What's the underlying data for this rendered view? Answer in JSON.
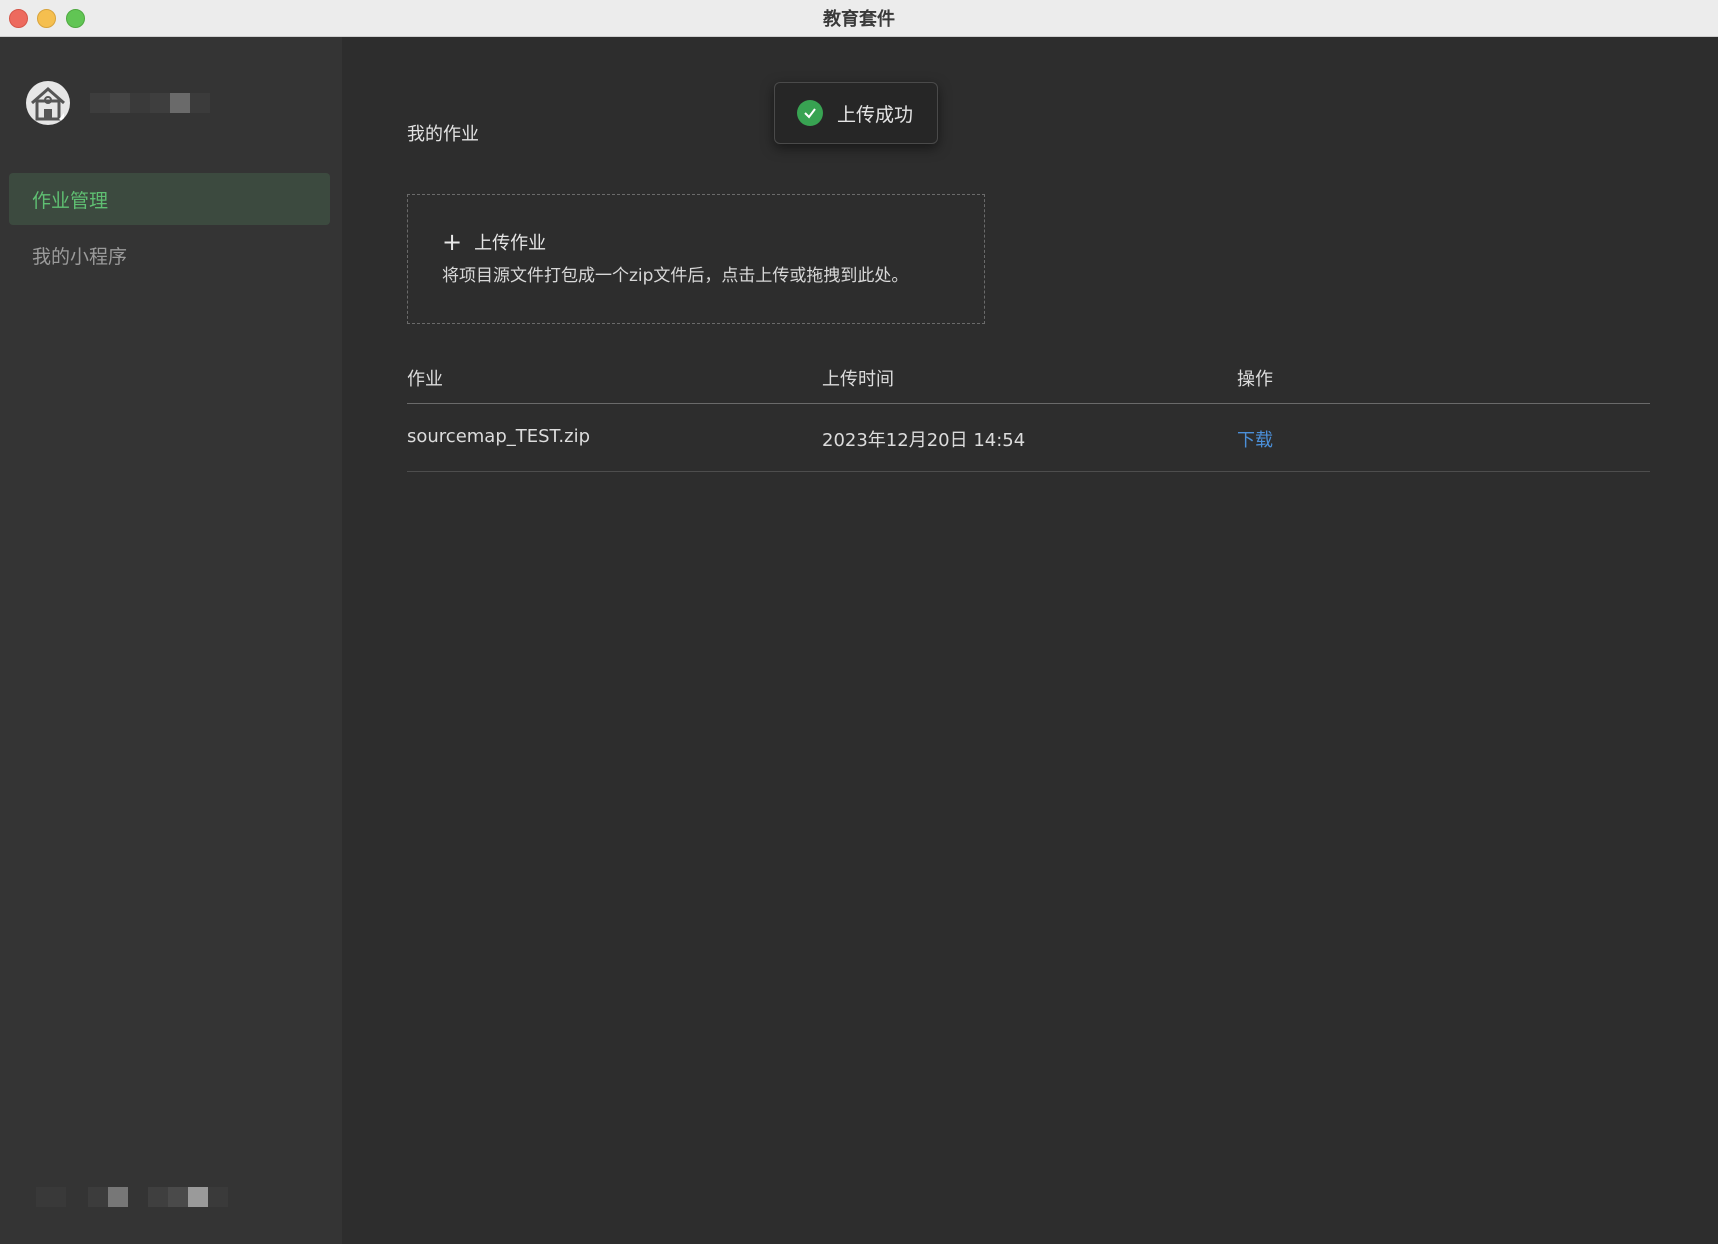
{
  "window": {
    "title": "教育套件"
  },
  "sidebar": {
    "logo_icon": "school-house-icon",
    "items": [
      {
        "label": "作业管理",
        "active": true
      },
      {
        "label": "我的小程序",
        "active": false
      }
    ]
  },
  "main": {
    "title": "我的作业",
    "toast": {
      "icon": "check-circle-icon",
      "text": "上传成功"
    },
    "upload": {
      "icon": "plus-icon",
      "title": "上传作业",
      "description": "将项目源文件打包成一个zip文件后，点击上传或拖拽到此处。"
    },
    "table": {
      "headers": [
        "作业",
        "上传时间",
        "操作"
      ],
      "rows": [
        {
          "name": "sourcemap_TEST.zip",
          "time": "2023年12月20日 14:54",
          "action": "下载"
        }
      ]
    }
  },
  "colors": {
    "accent_green": "#5fbf72",
    "link_blue": "#4b8fd8",
    "success": "#38a352"
  }
}
